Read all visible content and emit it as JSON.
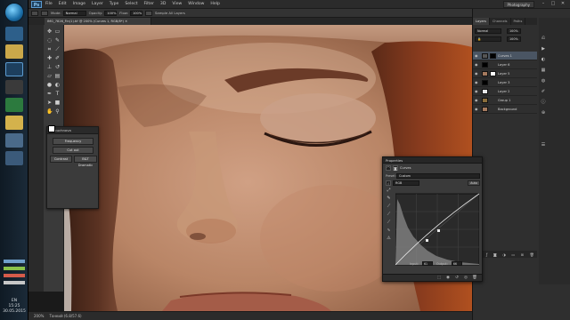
{
  "menubar": {
    "logo": "Ps",
    "items": [
      "File",
      "Edit",
      "Image",
      "Layer",
      "Type",
      "Select",
      "Filter",
      "3D",
      "View",
      "Window",
      "Help"
    ],
    "workspace": "Photography",
    "controls": [
      "–",
      "□",
      "✕"
    ]
  },
  "options": {
    "mode_label": "Mode:",
    "mode_value": "Normal",
    "opacity_label": "Opacity:",
    "opacity_value": "100%",
    "flow_label": "Flow:",
    "flow_value": "100%",
    "sample_label": "Sample All Layers"
  },
  "document": {
    "tab": "IMG_7826_Fin(1).tif @ 200% (Curves 1, RGB/8*) ✕"
  },
  "plugin_panel": {
    "title": "retouchnova",
    "buttons": [
      "Frequency",
      "Cut out",
      "Contrast",
      "B&T Dramatic"
    ]
  },
  "layers_panel": {
    "tabs": [
      "Layers",
      "Channels",
      "Paths"
    ],
    "blend_mode": "Normal",
    "opacity": "100%",
    "fill": "100%",
    "layers": [
      {
        "name": "Curves 1",
        "selected": true
      },
      {
        "name": "Layer 6",
        "selected": false
      },
      {
        "name": "Layer 5",
        "selected": false
      },
      {
        "name": "Layer 3",
        "selected": false
      },
      {
        "name": "Layer 2",
        "selected": false
      },
      {
        "name": "Group 1",
        "selected": false
      },
      {
        "name": "Background",
        "selected": false
      }
    ]
  },
  "properties": {
    "title": "Properties",
    "adjustment": "Curves",
    "preset_label": "Preset:",
    "preset_value": "Custom",
    "channel_value": "RGB",
    "auto_label": "Auto",
    "input_label": "Input:",
    "input_value": "61",
    "output_label": "Output:",
    "output_value": "66"
  },
  "statusbar": {
    "zoom": "200%",
    "doc_info": "Тонкий (6.8/57.6)"
  },
  "taskbar": {
    "lang": "EN",
    "time": "15:25",
    "date": "30.05.2015"
  },
  "colors": {
    "accent": "#4a5563",
    "fg": "#ffffff",
    "bg": "#000000"
  }
}
